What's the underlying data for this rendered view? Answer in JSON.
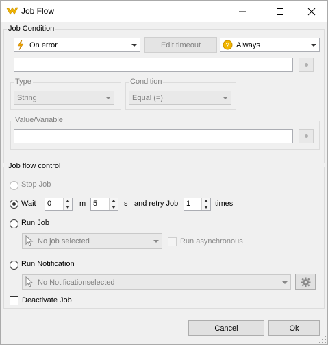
{
  "window": {
    "title": "Job Flow",
    "accent_color": "#f2b600"
  },
  "job_condition": {
    "group_title": "Job Condition",
    "trigger_select": "On error",
    "edit_timeout_label": "Edit timeout",
    "frequency_select": "Always",
    "type_group_title": "Type",
    "type_select": "String",
    "condition_group_title": "Condition",
    "condition_select": "Equal (=)",
    "value_group_title": "Value/Variable"
  },
  "job_flow_control": {
    "group_title": "Job flow control",
    "stop_job_label": "Stop Job",
    "wait_label": "Wait",
    "wait_minutes": "0",
    "minutes_unit": "m",
    "wait_seconds": "5",
    "seconds_unit": "s",
    "retry_label": "and retry Job",
    "retry_times": "1",
    "times_label": "times",
    "run_job_label": "Run Job",
    "job_select": "No job selected",
    "run_async_label": "Run asynchronous",
    "run_notification_label": "Run Notification",
    "notification_select": "No Notificationselected",
    "deactivate_job_label": "Deactivate Job"
  },
  "footer": {
    "cancel_label": "Cancel",
    "ok_label": "Ok"
  }
}
